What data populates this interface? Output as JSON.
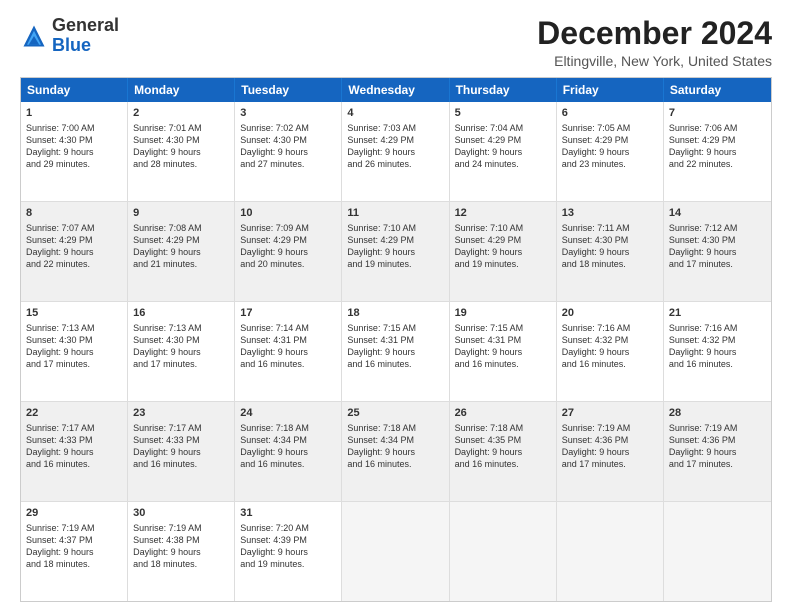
{
  "header": {
    "logo_general": "General",
    "logo_blue": "Blue",
    "title": "December 2024",
    "subtitle": "Eltingville, New York, United States"
  },
  "days": [
    "Sunday",
    "Monday",
    "Tuesday",
    "Wednesday",
    "Thursday",
    "Friday",
    "Saturday"
  ],
  "weeks": [
    [
      {
        "num": "1",
        "info": "Sunrise: 7:00 AM\nSunset: 4:30 PM\nDaylight: 9 hours\nand 29 minutes.",
        "shaded": false
      },
      {
        "num": "2",
        "info": "Sunrise: 7:01 AM\nSunset: 4:30 PM\nDaylight: 9 hours\nand 28 minutes.",
        "shaded": false
      },
      {
        "num": "3",
        "info": "Sunrise: 7:02 AM\nSunset: 4:30 PM\nDaylight: 9 hours\nand 27 minutes.",
        "shaded": false
      },
      {
        "num": "4",
        "info": "Sunrise: 7:03 AM\nSunset: 4:29 PM\nDaylight: 9 hours\nand 26 minutes.",
        "shaded": false
      },
      {
        "num": "5",
        "info": "Sunrise: 7:04 AM\nSunset: 4:29 PM\nDaylight: 9 hours\nand 24 minutes.",
        "shaded": false
      },
      {
        "num": "6",
        "info": "Sunrise: 7:05 AM\nSunset: 4:29 PM\nDaylight: 9 hours\nand 23 minutes.",
        "shaded": false
      },
      {
        "num": "7",
        "info": "Sunrise: 7:06 AM\nSunset: 4:29 PM\nDaylight: 9 hours\nand 22 minutes.",
        "shaded": false
      }
    ],
    [
      {
        "num": "8",
        "info": "Sunrise: 7:07 AM\nSunset: 4:29 PM\nDaylight: 9 hours\nand 22 minutes.",
        "shaded": true
      },
      {
        "num": "9",
        "info": "Sunrise: 7:08 AM\nSunset: 4:29 PM\nDaylight: 9 hours\nand 21 minutes.",
        "shaded": true
      },
      {
        "num": "10",
        "info": "Sunrise: 7:09 AM\nSunset: 4:29 PM\nDaylight: 9 hours\nand 20 minutes.",
        "shaded": true
      },
      {
        "num": "11",
        "info": "Sunrise: 7:10 AM\nSunset: 4:29 PM\nDaylight: 9 hours\nand 19 minutes.",
        "shaded": true
      },
      {
        "num": "12",
        "info": "Sunrise: 7:10 AM\nSunset: 4:29 PM\nDaylight: 9 hours\nand 19 minutes.",
        "shaded": true
      },
      {
        "num": "13",
        "info": "Sunrise: 7:11 AM\nSunset: 4:30 PM\nDaylight: 9 hours\nand 18 minutes.",
        "shaded": true
      },
      {
        "num": "14",
        "info": "Sunrise: 7:12 AM\nSunset: 4:30 PM\nDaylight: 9 hours\nand 17 minutes.",
        "shaded": true
      }
    ],
    [
      {
        "num": "15",
        "info": "Sunrise: 7:13 AM\nSunset: 4:30 PM\nDaylight: 9 hours\nand 17 minutes.",
        "shaded": false
      },
      {
        "num": "16",
        "info": "Sunrise: 7:13 AM\nSunset: 4:30 PM\nDaylight: 9 hours\nand 17 minutes.",
        "shaded": false
      },
      {
        "num": "17",
        "info": "Sunrise: 7:14 AM\nSunset: 4:31 PM\nDaylight: 9 hours\nand 16 minutes.",
        "shaded": false
      },
      {
        "num": "18",
        "info": "Sunrise: 7:15 AM\nSunset: 4:31 PM\nDaylight: 9 hours\nand 16 minutes.",
        "shaded": false
      },
      {
        "num": "19",
        "info": "Sunrise: 7:15 AM\nSunset: 4:31 PM\nDaylight: 9 hours\nand 16 minutes.",
        "shaded": false
      },
      {
        "num": "20",
        "info": "Sunrise: 7:16 AM\nSunset: 4:32 PM\nDaylight: 9 hours\nand 16 minutes.",
        "shaded": false
      },
      {
        "num": "21",
        "info": "Sunrise: 7:16 AM\nSunset: 4:32 PM\nDaylight: 9 hours\nand 16 minutes.",
        "shaded": false
      }
    ],
    [
      {
        "num": "22",
        "info": "Sunrise: 7:17 AM\nSunset: 4:33 PM\nDaylight: 9 hours\nand 16 minutes.",
        "shaded": true
      },
      {
        "num": "23",
        "info": "Sunrise: 7:17 AM\nSunset: 4:33 PM\nDaylight: 9 hours\nand 16 minutes.",
        "shaded": true
      },
      {
        "num": "24",
        "info": "Sunrise: 7:18 AM\nSunset: 4:34 PM\nDaylight: 9 hours\nand 16 minutes.",
        "shaded": true
      },
      {
        "num": "25",
        "info": "Sunrise: 7:18 AM\nSunset: 4:34 PM\nDaylight: 9 hours\nand 16 minutes.",
        "shaded": true
      },
      {
        "num": "26",
        "info": "Sunrise: 7:18 AM\nSunset: 4:35 PM\nDaylight: 9 hours\nand 16 minutes.",
        "shaded": true
      },
      {
        "num": "27",
        "info": "Sunrise: 7:19 AM\nSunset: 4:36 PM\nDaylight: 9 hours\nand 17 minutes.",
        "shaded": true
      },
      {
        "num": "28",
        "info": "Sunrise: 7:19 AM\nSunset: 4:36 PM\nDaylight: 9 hours\nand 17 minutes.",
        "shaded": true
      }
    ],
    [
      {
        "num": "29",
        "info": "Sunrise: 7:19 AM\nSunset: 4:37 PM\nDaylight: 9 hours\nand 18 minutes.",
        "shaded": false
      },
      {
        "num": "30",
        "info": "Sunrise: 7:19 AM\nSunset: 4:38 PM\nDaylight: 9 hours\nand 18 minutes.",
        "shaded": false
      },
      {
        "num": "31",
        "info": "Sunrise: 7:20 AM\nSunset: 4:39 PM\nDaylight: 9 hours\nand 19 minutes.",
        "shaded": false
      },
      {
        "num": "",
        "info": "",
        "shaded": false,
        "empty": true
      },
      {
        "num": "",
        "info": "",
        "shaded": false,
        "empty": true
      },
      {
        "num": "",
        "info": "",
        "shaded": false,
        "empty": true
      },
      {
        "num": "",
        "info": "",
        "shaded": false,
        "empty": true
      }
    ]
  ]
}
